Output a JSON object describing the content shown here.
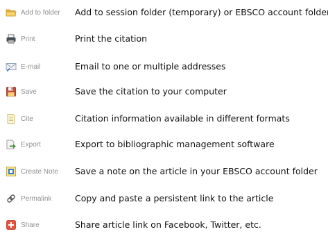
{
  "rows": [
    {
      "icon": "folder-icon",
      "label": "Add to folder",
      "description": "Add to session folder (temporary) or EBSCO account folder"
    },
    {
      "icon": "printer-icon",
      "label": "Print",
      "description": "Print the citation"
    },
    {
      "icon": "email-icon",
      "label": "E-mail",
      "description": "Email to one or multiple addresses"
    },
    {
      "icon": "floppy-disk-icon",
      "label": "Save",
      "description": "Save the citation to your computer"
    },
    {
      "icon": "document-icon",
      "label": "Cite",
      "description": "Citation information available in different formats"
    },
    {
      "icon": "export-icon",
      "label": "Export",
      "description": "Export to bibliographic management software"
    },
    {
      "icon": "note-icon",
      "label": "Create Note",
      "description": "Save a note on the  article in your EBSCO account folder"
    },
    {
      "icon": "link-icon",
      "label": "Permalink",
      "description": "Copy and paste a persistent link to the article"
    },
    {
      "icon": "share-plus-icon",
      "label": "Share",
      "description": "Share article link on Facebook, Twitter, etc."
    }
  ],
  "colors": {
    "label": "#8f8f8f",
    "description": "#111111",
    "folder": "#f2c94c",
    "save": "#c0392b",
    "share": "#e5533b",
    "note": "#3a7bd5"
  }
}
